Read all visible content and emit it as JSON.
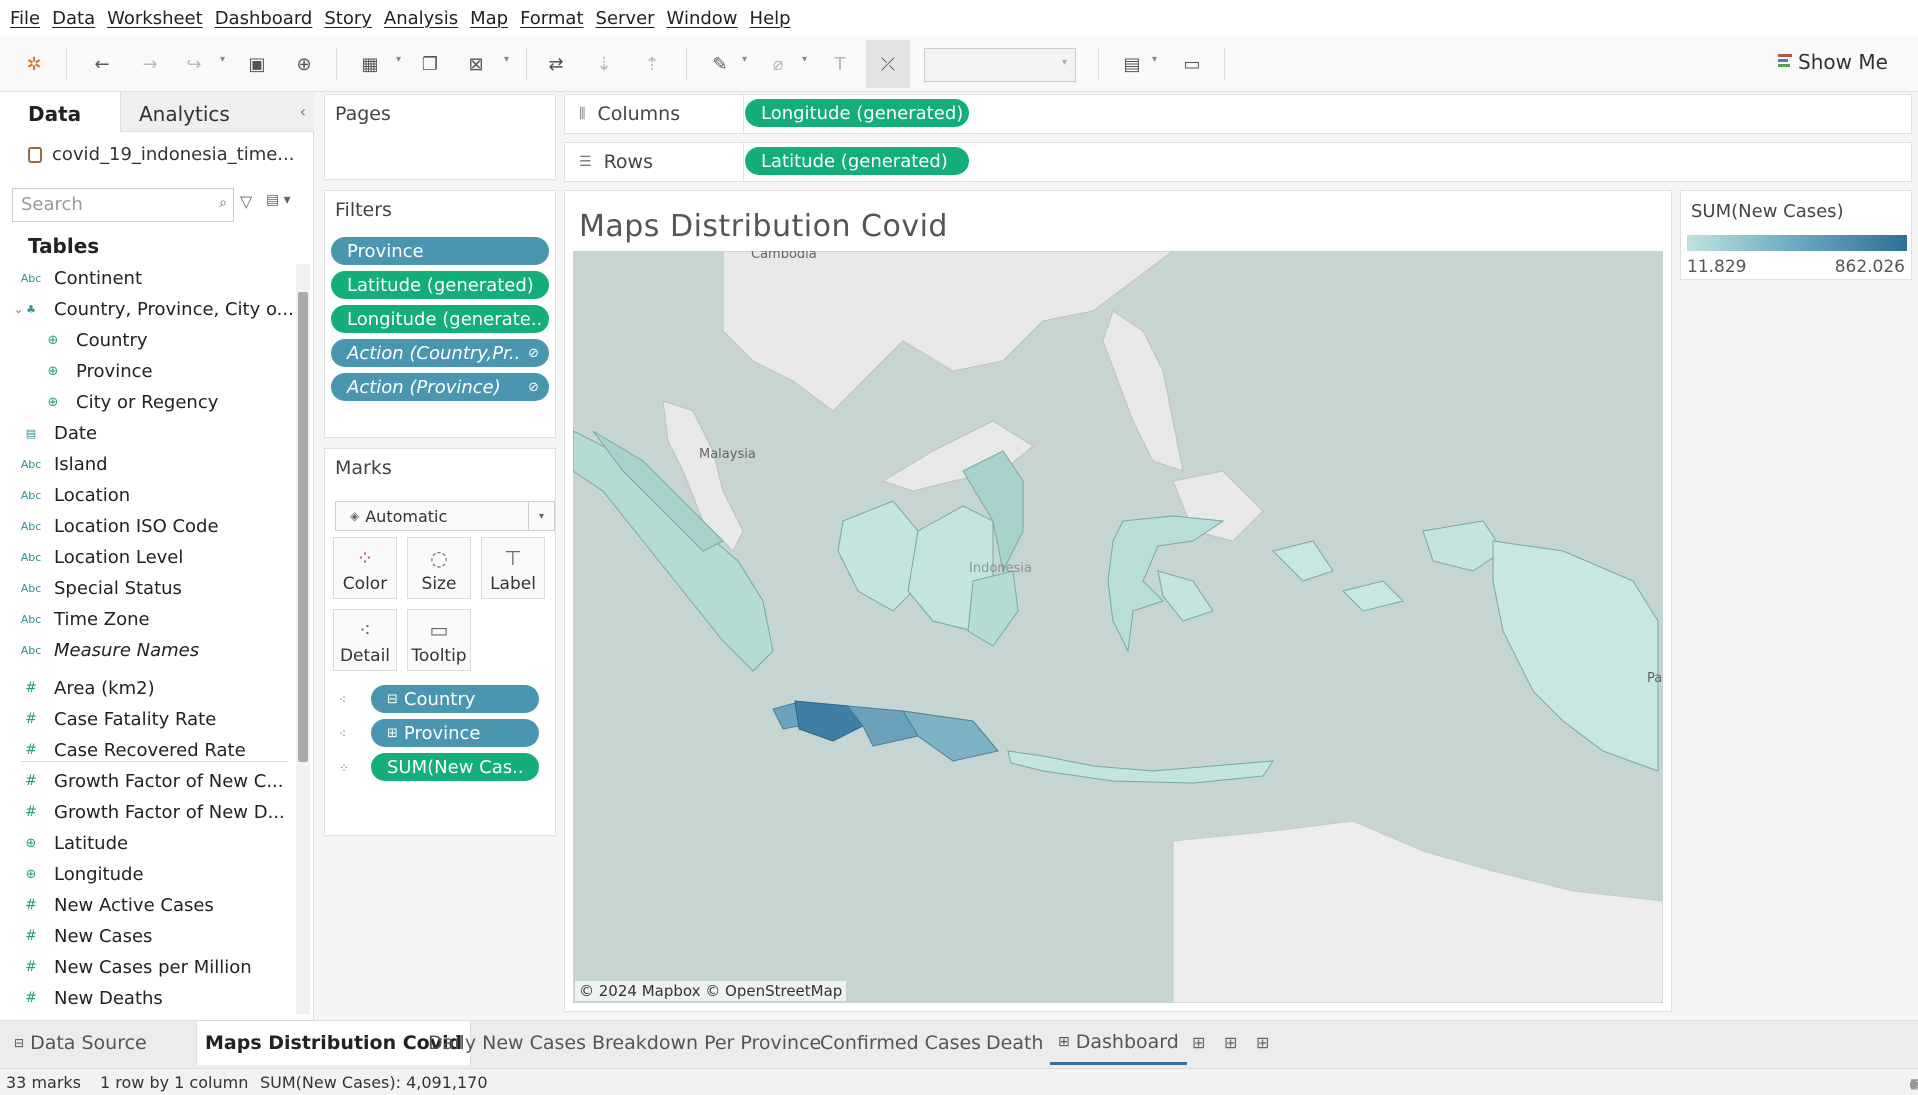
{
  "menu": [
    "File",
    "Data",
    "Worksheet",
    "Dashboard",
    "Story",
    "Analysis",
    "Map",
    "Format",
    "Server",
    "Window",
    "Help"
  ],
  "toolbar": {
    "show_me": "Show Me"
  },
  "data_pane": {
    "tab_data": "Data",
    "tab_analytics": "Analytics",
    "datasource": "covid_19_indonesia_time...",
    "search_placeholder": "Search",
    "tables_heading": "Tables",
    "fields": [
      {
        "label": "Continent",
        "type": "Abc"
      },
      {
        "label": "Country, Province, City o...",
        "type": "hierarchy"
      },
      {
        "label": "Country",
        "type": "geo"
      },
      {
        "label": "Province",
        "type": "geo"
      },
      {
        "label": "City or Regency",
        "type": "geo"
      },
      {
        "label": "Date",
        "type": "date"
      },
      {
        "label": "Island",
        "type": "Abc"
      },
      {
        "label": "Location",
        "type": "Abc"
      },
      {
        "label": "Location ISO Code",
        "type": "Abc"
      },
      {
        "label": "Location Level",
        "type": "Abc"
      },
      {
        "label": "Special Status",
        "type": "Abc"
      },
      {
        "label": "Time Zone",
        "type": "Abc"
      },
      {
        "label": "Measure Names",
        "type": "Abc"
      },
      {
        "label": "Area (km2)",
        "type": "#"
      },
      {
        "label": "Case Fatality Rate",
        "type": "#"
      },
      {
        "label": "Case Recovered Rate",
        "type": "#"
      },
      {
        "label": "Growth Factor of New C...",
        "type": "#"
      },
      {
        "label": "Growth Factor of New D...",
        "type": "#"
      },
      {
        "label": "Latitude",
        "type": "geo"
      },
      {
        "label": "Longitude",
        "type": "geo"
      },
      {
        "label": "New Active Cases",
        "type": "#"
      },
      {
        "label": "New Cases",
        "type": "#"
      },
      {
        "label": "New Cases per Million",
        "type": "#"
      },
      {
        "label": "New Deaths",
        "type": "#"
      }
    ]
  },
  "pages": {
    "title": "Pages"
  },
  "filters": {
    "title": "Filters",
    "pills": [
      "Province",
      "Latitude (generated)",
      "Longitude (generate..",
      "Action (Country,Pr..",
      "Action (Province)"
    ]
  },
  "marks": {
    "title": "Marks",
    "type": "Automatic",
    "buttons": [
      "Color",
      "Size",
      "Label",
      "Detail",
      "Tooltip"
    ],
    "fields": [
      "Country",
      "Province",
      "SUM(New Cas.."
    ]
  },
  "shelves": {
    "columns_label": "Columns",
    "columns_pill": "Longitude (generated)",
    "rows_label": "Rows",
    "rows_pill": "Latitude (generated)"
  },
  "view": {
    "title": "Maps Distribution Covid",
    "attribution": "© 2024 Mapbox © OpenStreetMap",
    "labels": {
      "cambodia": "Cambodia",
      "malaysia": "Malaysia",
      "indonesia": "Indonesia",
      "pa": "Pa"
    }
  },
  "legend": {
    "title": "SUM(New Cases)",
    "min": "11.829",
    "max": "862.026",
    "colors": {
      "low": "#bfe2dd",
      "mid": "#6aa9c2",
      "high": "#2f6f95"
    }
  },
  "sheet_tabs": {
    "data_source": "Data Source",
    "sheets": [
      "Maps Distribution Covid",
      "Daily New Cases",
      "Breakdown Per Province",
      "Confirmed Cases",
      "Death",
      "Dashboard"
    ]
  },
  "status": {
    "marks": "33 marks",
    "dims": "1 row by 1 column",
    "sum": "SUM(New Cases): 4,091,170"
  }
}
